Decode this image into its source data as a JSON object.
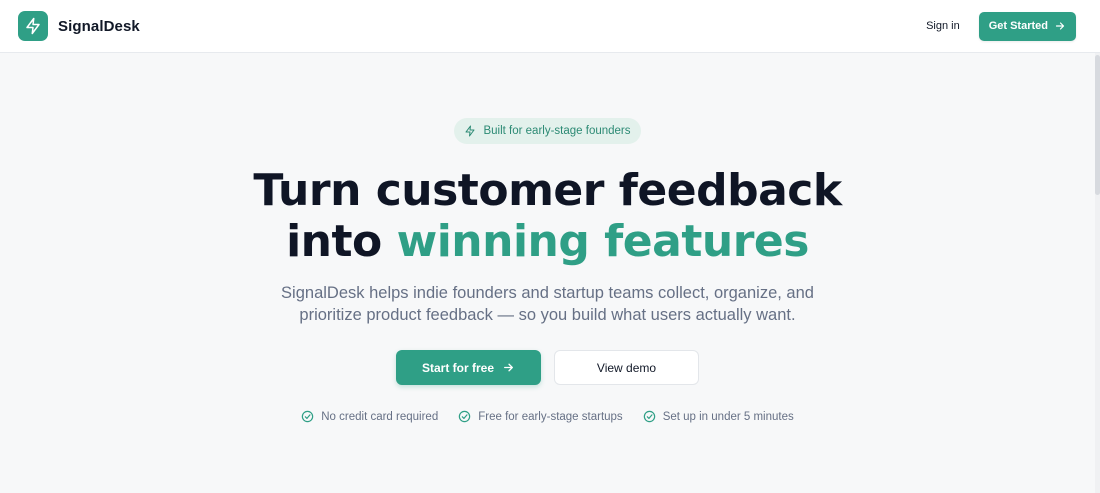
{
  "header": {
    "brand_name": "SignalDesk",
    "logo_icon": "bolt-icon",
    "sign_in_label": "Sign in",
    "get_started_label": "Get Started"
  },
  "hero": {
    "badge_label": "Built for early-stage founders",
    "headline_line1": "Turn customer feedback",
    "headline_line2_plain": "into",
    "headline_line2_accent": "winning features",
    "subheadline_line1": "SignalDesk helps indie founders and startup teams collect, organize, and",
    "subheadline_line2": "prioritize product feedback — so you build what users actually want.",
    "primary_cta": "Start for free",
    "secondary_cta": "View demo",
    "checks": [
      "No credit card required",
      "Free for early-stage startups",
      "Set up in under 5 minutes"
    ]
  },
  "colors": {
    "accent": "#2f9f86",
    "badge_bg": "#e3f1ec",
    "heading": "#0f1525",
    "muted": "#667085"
  }
}
